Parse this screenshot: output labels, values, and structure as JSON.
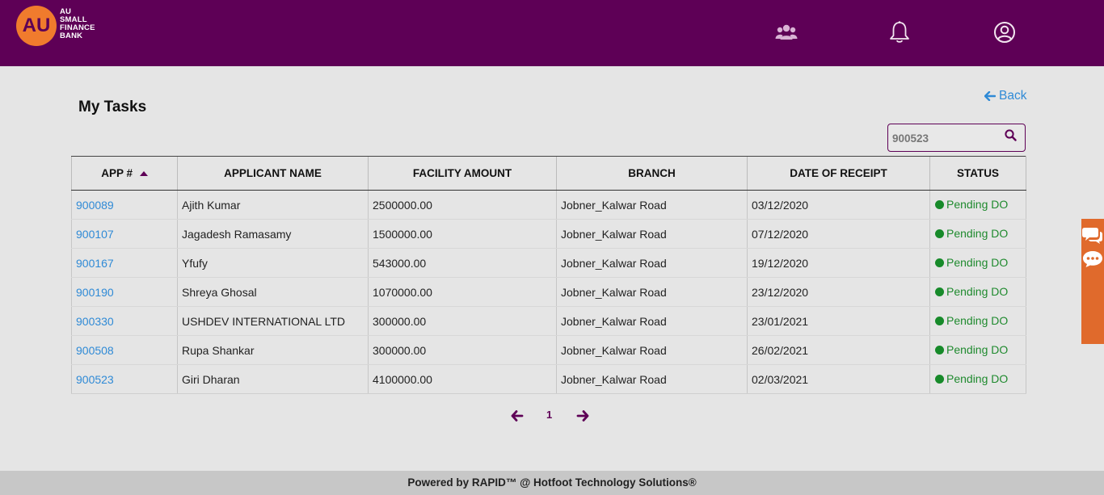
{
  "header": {
    "logo_mark": "AU",
    "logo_lines": [
      "AU",
      "SMALL",
      "FINANCE",
      "BANK"
    ],
    "icons": [
      "users-icon",
      "bell-icon",
      "user-profile-icon"
    ],
    "brand_color": "#5e0056",
    "accent_color": "#f07b2d"
  },
  "page": {
    "title": "My Tasks",
    "back_label": "Back"
  },
  "search": {
    "value": "900523",
    "placeholder": ""
  },
  "table": {
    "columns": [
      "APP #",
      "APPLICANT NAME",
      "FACILITY AMOUNT",
      "BRANCH",
      "DATE OF RECEIPT",
      "STATUS"
    ],
    "sort_column": "APP #",
    "sort_direction": "ascending",
    "rows": [
      {
        "app": "900089",
        "name": "Ajith Kumar",
        "amount": "2500000.00",
        "branch": "Jobner_Kalwar Road",
        "date": "03/12/2020",
        "status": "Pending DO"
      },
      {
        "app": "900107",
        "name": "Jagadesh Ramasamy",
        "amount": "1500000.00",
        "branch": "Jobner_Kalwar Road",
        "date": "07/12/2020",
        "status": "Pending DO"
      },
      {
        "app": "900167",
        "name": "Yfufy",
        "amount": "543000.00",
        "branch": "Jobner_Kalwar Road",
        "date": "19/12/2020",
        "status": "Pending DO"
      },
      {
        "app": "900190",
        "name": "Shreya Ghosal",
        "amount": "1070000.00",
        "branch": "Jobner_Kalwar Road",
        "date": "23/12/2020",
        "status": "Pending DO"
      },
      {
        "app": "900330",
        "name": "USHDEV INTERNATIONAL LTD",
        "amount": "300000.00",
        "branch": "Jobner_Kalwar Road",
        "date": "23/01/2021",
        "status": "Pending DO"
      },
      {
        "app": "900508",
        "name": "Rupa Shankar",
        "amount": "300000.00",
        "branch": "Jobner_Kalwar Road",
        "date": "26/02/2021",
        "status": "Pending DO"
      },
      {
        "app": "900523",
        "name": "Giri Dharan",
        "amount": "4100000.00",
        "branch": "Jobner_Kalwar Road",
        "date": "02/03/2021",
        "status": "Pending DO"
      }
    ],
    "status_color": "#178a2a",
    "link_color": "#2f8ad6"
  },
  "pagination": {
    "current_page": "1"
  },
  "side_tab": {
    "icons": [
      "chat-bubbles-icon",
      "chat-dots-icon"
    ],
    "color": "#e06a2c"
  },
  "footer": {
    "text": "Powered by RAPID™ @ Hotfoot Technology Solutions®"
  }
}
